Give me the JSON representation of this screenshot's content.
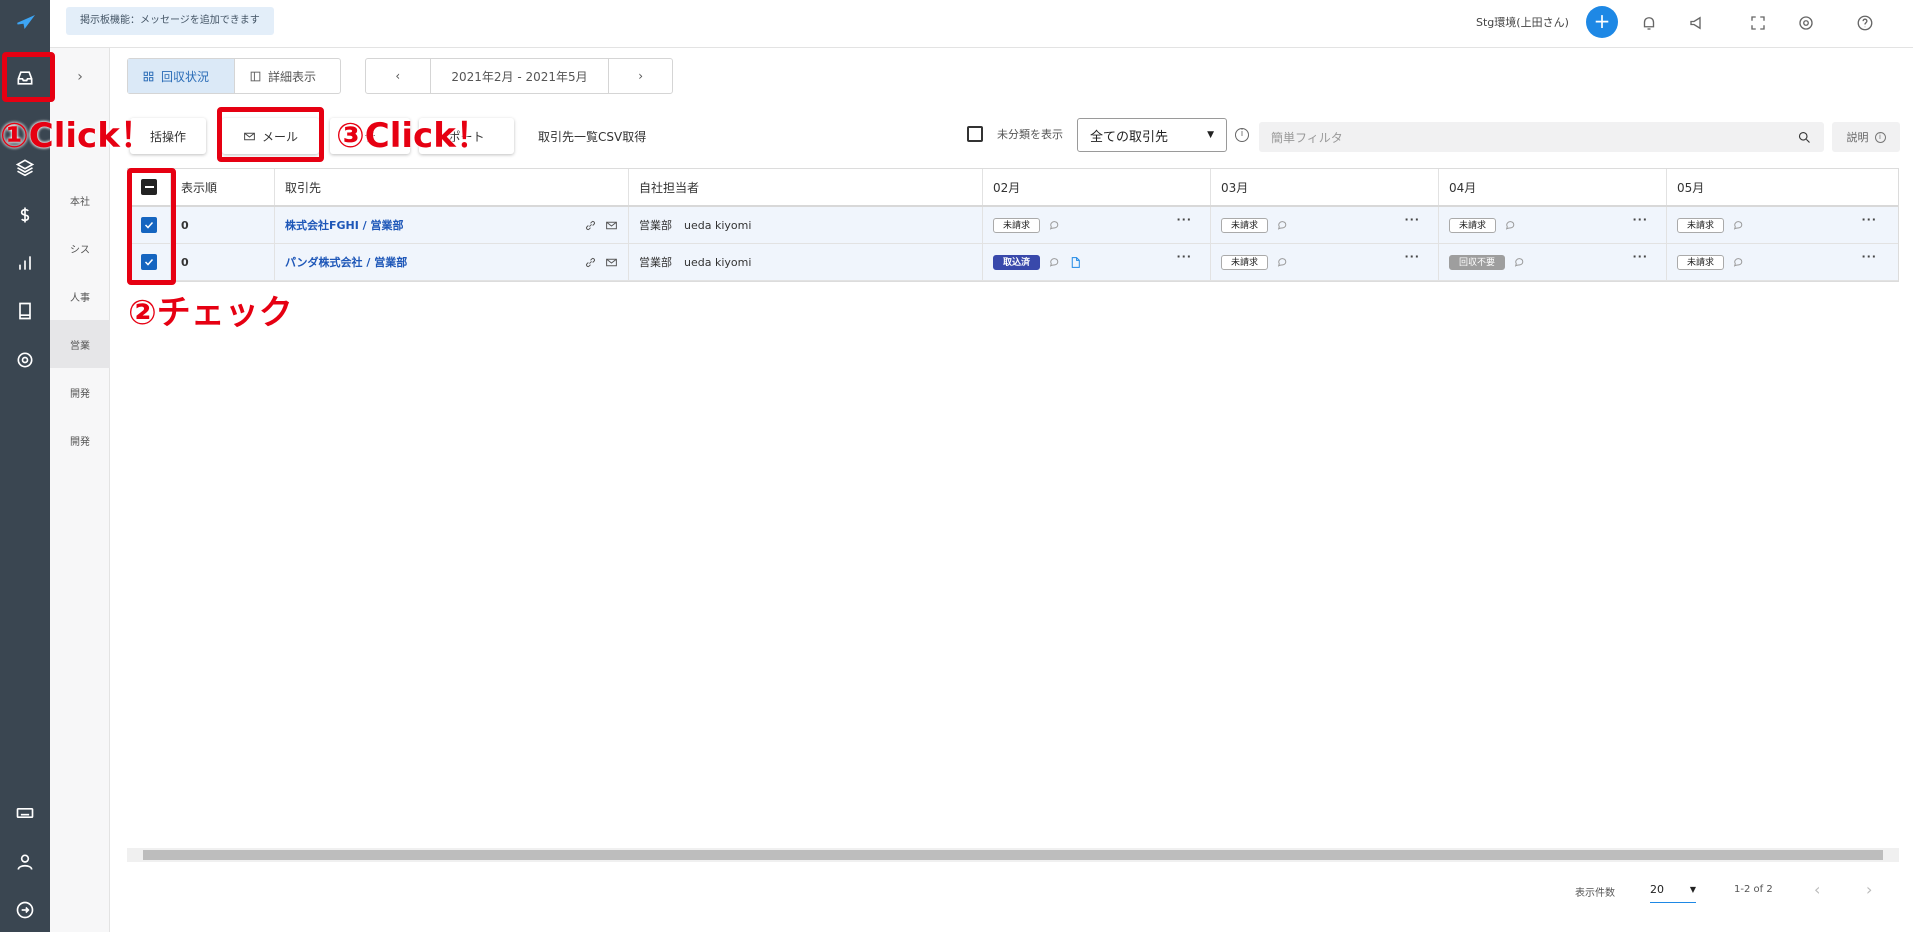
{
  "topbar": {
    "notice": "掲示板機能：メッセージを追加できます",
    "env_label": "Stg環境(上田さん)",
    "plus_label": "+"
  },
  "subnav": {
    "expand": "›",
    "items": [
      "本社",
      "シス",
      "人事",
      "営業",
      "開発",
      "開発"
    ]
  },
  "toolbar": {
    "view_tabs": [
      "回収状況",
      "詳細表示"
    ],
    "date_range": "2021年2月 - 2021年5月",
    "prev": "‹",
    "next": "›",
    "bulk_label": "括操作",
    "mail_label": "メール",
    "btn3_label": "テ",
    "btn4_label": "ポート",
    "csv_label": "取引先一覧CSV取得",
    "unclassified_label": "未分類を表示",
    "client_select": "全ての取引先",
    "filter_placeholder": "簡単フィルタ",
    "help_label": "説明"
  },
  "table": {
    "headers": [
      "表示順",
      "取引先",
      "自社担当者",
      "02月",
      "03月",
      "04月",
      "05月"
    ],
    "rows": [
      {
        "order": "0",
        "client": "株式会社FGHI / 営業部",
        "dept": "営業部",
        "person": "ueda kiyomi",
        "months": [
          "未請求",
          "未請求",
          "未請求",
          "未請求"
        ]
      },
      {
        "order": "0",
        "client": "パンダ株式会社 / 営業部",
        "dept": "営業部",
        "person": "ueda kiyomi",
        "months": [
          "取込済",
          "未請求",
          "回収不要",
          "未請求"
        ]
      }
    ]
  },
  "pagination": {
    "per_page_label": "表示件数",
    "per_page": "20",
    "range": "1-2 of 2"
  },
  "annotations": {
    "a1": "①Click！",
    "a2": "②チェック",
    "a3": "③Click！"
  },
  "colors": {
    "accent": "#1e88e5",
    "annotation": "#e60012",
    "rail": "#3a4651"
  }
}
